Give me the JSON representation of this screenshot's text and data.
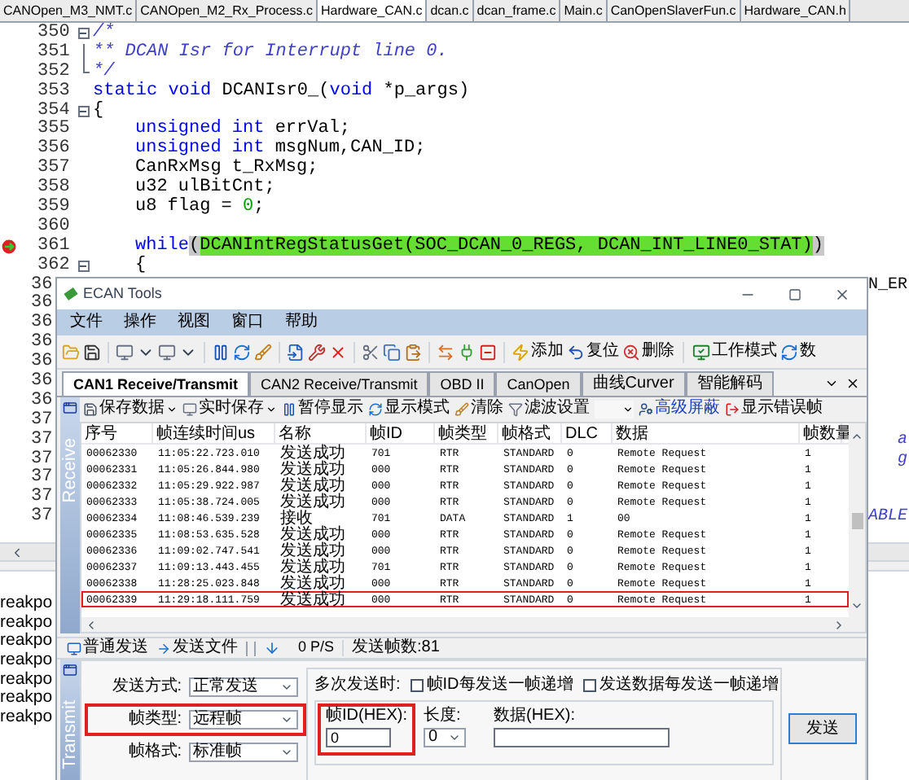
{
  "editor": {
    "tabs": [
      {
        "label": "CANOpen_M3_NMT.c",
        "selected": false
      },
      {
        "label": "CANOpen_M2_Rx_Process.c",
        "selected": false
      },
      {
        "label": "Hardware_CAN.c",
        "selected": true
      },
      {
        "label": "dcan.c",
        "selected": false
      },
      {
        "label": "dcan_frame.c",
        "selected": false
      },
      {
        "label": "Main.c",
        "selected": false
      },
      {
        "label": "CanOpenSlaverFun.c",
        "selected": false
      },
      {
        "label": "Hardware_CAN.h",
        "selected": false
      }
    ],
    "lines": [
      {
        "number": "350",
        "fold": {
          "kind": "start"
        },
        "breakpoint": false,
        "indented": false,
        "tokens": [
          {
            "kind": "comment",
            "text": "/*"
          }
        ]
      },
      {
        "number": "351",
        "fold": {
          "kind": "line"
        },
        "breakpoint": false,
        "indented": false,
        "tokens": [
          {
            "kind": "comment",
            "text": "** DCAN Isr for Interrupt line 0."
          }
        ]
      },
      {
        "number": "352",
        "fold": {
          "kind": "end"
        },
        "breakpoint": false,
        "indented": false,
        "tokens": [
          {
            "kind": "comment",
            "text": "*/"
          }
        ]
      },
      {
        "number": "353",
        "breakpoint": false,
        "indented": false,
        "tokens": [
          {
            "kind": "keyword",
            "text": "static void"
          },
          {
            "kind": "plain",
            "text": " DCANIsr0_("
          },
          {
            "kind": "keyword",
            "text": "void"
          },
          {
            "kind": "plain",
            "text": " *p_args)"
          }
        ]
      },
      {
        "number": "354",
        "fold": {
          "kind": "start"
        },
        "breakpoint": false,
        "indented": false,
        "tokens": [
          {
            "kind": "plain",
            "text": "{"
          }
        ]
      },
      {
        "number": "355",
        "breakpoint": false,
        "indented": true,
        "tokens": [
          {
            "kind": "keyword",
            "text": "unsigned int"
          },
          {
            "kind": "plain",
            "text": " errVal;"
          }
        ]
      },
      {
        "number": "356",
        "breakpoint": false,
        "indented": true,
        "tokens": [
          {
            "kind": "keyword",
            "text": "unsigned int"
          },
          {
            "kind": "plain",
            "text": " msgNum,CAN_ID;"
          }
        ]
      },
      {
        "number": "357",
        "breakpoint": false,
        "indented": true,
        "tokens": [
          {
            "kind": "plain",
            "text": "CanRxMsg t_RxMsg;"
          }
        ]
      },
      {
        "number": "358",
        "breakpoint": false,
        "indented": true,
        "tokens": [
          {
            "kind": "plain",
            "text": "u32 ulBitCnt;"
          }
        ]
      },
      {
        "number": "359",
        "breakpoint": false,
        "indented": true,
        "tokens": [
          {
            "kind": "plain",
            "text": "u8 flag = "
          },
          {
            "kind": "number",
            "text": "0"
          },
          {
            "kind": "plain",
            "text": ";"
          }
        ]
      },
      {
        "number": "360",
        "breakpoint": false
      },
      {
        "number": "361",
        "breakpoint": true,
        "indented": true,
        "tokens": [
          {
            "kind": "keyword",
            "text": "while"
          },
          {
            "kind": "match",
            "text": "("
          },
          {
            "kind": "highlight",
            "text": "DCANIntRegStatusGet(SOC_DCAN_0_REGS, DCAN_INT_LINE0_STAT)"
          },
          {
            "kind": "match",
            "text": ")"
          }
        ]
      },
      {
        "number": "362",
        "fold": {
          "kind": "start"
        },
        "breakpoint": false,
        "indented": true,
        "tokens": [
          {
            "kind": "plain",
            "text": "{"
          }
        ]
      }
    ],
    "cut_lines": [
      {
        "number": "36",
        "tail": {
          "kind": "plain",
          "text": "N_ER"
        }
      },
      {
        "number": "36"
      },
      {
        "number": "36"
      },
      {
        "number": "36"
      },
      {
        "number": "36"
      },
      {
        "number": "36"
      },
      {
        "number": "36"
      },
      {
        "number": "37"
      },
      {
        "number": "37",
        "tail": {
          "kind": "comment",
          "text": "a"
        }
      },
      {
        "number": "37",
        "tail": {
          "kind": "comment",
          "text": "g"
        }
      },
      {
        "number": "37"
      },
      {
        "number": "37"
      },
      {
        "number": "37",
        "tail": {
          "kind": "comment",
          "text": "ABLE"
        }
      }
    ]
  },
  "output": {
    "lines": [
      "reakpo",
      "reakpo",
      "reakpo",
      "reakpo",
      "reakpo",
      "reakpo",
      "reakpo"
    ]
  },
  "ecan_window": {
    "title": "ECAN Tools",
    "menu": [
      "文件",
      "操作",
      "视图",
      "窗口",
      "帮助"
    ],
    "toolbar_labels": [
      "添加",
      "复位",
      "删除",
      "工作模式",
      "数"
    ],
    "tabs": [
      {
        "label": "CAN1 Receive/Transmit",
        "selected": true
      },
      {
        "label": "CAN2 Receive/Transmit",
        "selected": false
      },
      {
        "label": "OBD II",
        "selected": false
      },
      {
        "label": "CanOpen",
        "selected": false
      },
      {
        "label": "曲线Curver",
        "selected": false
      },
      {
        "label": "智能解码",
        "selected": false
      }
    ],
    "receive": {
      "side_label": "Receive",
      "toolbar": {
        "save": "保存数据",
        "realtime_save": "实时保存",
        "pause": "暂停显示",
        "display_mode": "显示模式",
        "clear": "清除",
        "filter": "滤波设置",
        "advanced_mask": "高级屏蔽",
        "show_errors": "显示错误帧"
      },
      "table": {
        "columns": [
          "序号",
          "帧连续时间us",
          "名称",
          "帧ID",
          "帧类型",
          "帧格式",
          "DLC",
          "数据",
          "帧数量"
        ],
        "rows": [
          {
            "cells": [
              "00062330",
              "11:05:22.723.010",
              "发送成功",
              "701",
              "RTR",
              "STANDARD",
              "0",
              "Remote Request",
              "1"
            ],
            "highlighted": false
          },
          {
            "cells": [
              "00062331",
              "11:05:26.844.980",
              "发送成功",
              "000",
              "RTR",
              "STANDARD",
              "0",
              "Remote Request",
              "1"
            ],
            "highlighted": false
          },
          {
            "cells": [
              "00062332",
              "11:05:29.922.987",
              "发送成功",
              "000",
              "RTR",
              "STANDARD",
              "0",
              "Remote Request",
              "1"
            ],
            "highlighted": false
          },
          {
            "cells": [
              "00062333",
              "11:05:38.724.005",
              "发送成功",
              "000",
              "RTR",
              "STANDARD",
              "0",
              "Remote Request",
              "1"
            ],
            "highlighted": false
          },
          {
            "cells": [
              "00062334",
              "11:08:46.539.239",
              "接收",
              "701",
              "DATA",
              "STANDARD",
              "1",
              "00",
              "1"
            ],
            "highlighted": false
          },
          {
            "cells": [
              "00062335",
              "11:08:53.635.528",
              "发送成功",
              "000",
              "RTR",
              "STANDARD",
              "0",
              "Remote Request",
              "1"
            ],
            "highlighted": false
          },
          {
            "cells": [
              "00062336",
              "11:09:02.747.541",
              "发送成功",
              "000",
              "RTR",
              "STANDARD",
              "0",
              "Remote Request",
              "1"
            ],
            "highlighted": false
          },
          {
            "cells": [
              "00062337",
              "11:09:13.443.455",
              "发送成功",
              "701",
              "RTR",
              "STANDARD",
              "0",
              "Remote Request",
              "1"
            ],
            "highlighted": false
          },
          {
            "cells": [
              "00062338",
              "11:28:25.023.848",
              "发送成功",
              "000",
              "RTR",
              "STANDARD",
              "0",
              "Remote Request",
              "1"
            ],
            "highlighted": false
          },
          {
            "cells": [
              "00062339",
              "11:29:18.111.759",
              "发送成功",
              "000",
              "RTR",
              "STANDARD",
              "0",
              "Remote Request",
              "1"
            ],
            "highlighted": true
          }
        ]
      }
    },
    "transmit": {
      "side_label": "Transmit",
      "toolbar": {
        "normal_send": "普通发送",
        "send_file": "发送文件",
        "rate": "0 P/S",
        "sent_count": "发送帧数:81"
      },
      "send_mode": {
        "label": "发送方式:",
        "value": "正常发送"
      },
      "frame_type": {
        "label": "帧类型:",
        "value": "远程帧",
        "highlighted": true
      },
      "frame_format": {
        "label": "帧格式:",
        "value": "标准帧"
      },
      "multi_send": {
        "label": "多次发送时:",
        "options": [
          {
            "label": "帧ID每发送一帧递增",
            "checked": false
          },
          {
            "label": "发送数据每发送一帧递增",
            "checked": false
          }
        ]
      },
      "frame_id": {
        "label": "帧ID(HEX):",
        "value": "0",
        "highlighted": true
      },
      "length": {
        "label": "长度:",
        "value": "0"
      },
      "data": {
        "label": "数据(HEX):"
      },
      "send_button": "发送"
    }
  }
}
